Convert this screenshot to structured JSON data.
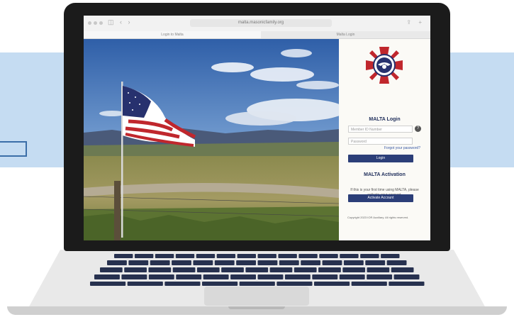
{
  "browser": {
    "url": "malta.masonicfamily.org",
    "tab1_label": "Login to Malta",
    "tab2_label": "Malta Login"
  },
  "login": {
    "title": "MALTA Login",
    "member_placeholder": "Member ID Number",
    "password_placeholder": "Password",
    "forgot_link": "Forgot your password?",
    "login_button": "Login"
  },
  "activation": {
    "title": "MALTA Activation",
    "description": "If this is your first time using MALTA, please activate your account.",
    "button": "Activate Account"
  },
  "footer": {
    "copyright": "Copyright 2023 IOR Auxiliary. All rights reserved."
  },
  "colors": {
    "accent": "#2b3e78",
    "band": "#c5dcf2",
    "logo_red": "#c0272d"
  },
  "icons": {
    "help": "?"
  }
}
